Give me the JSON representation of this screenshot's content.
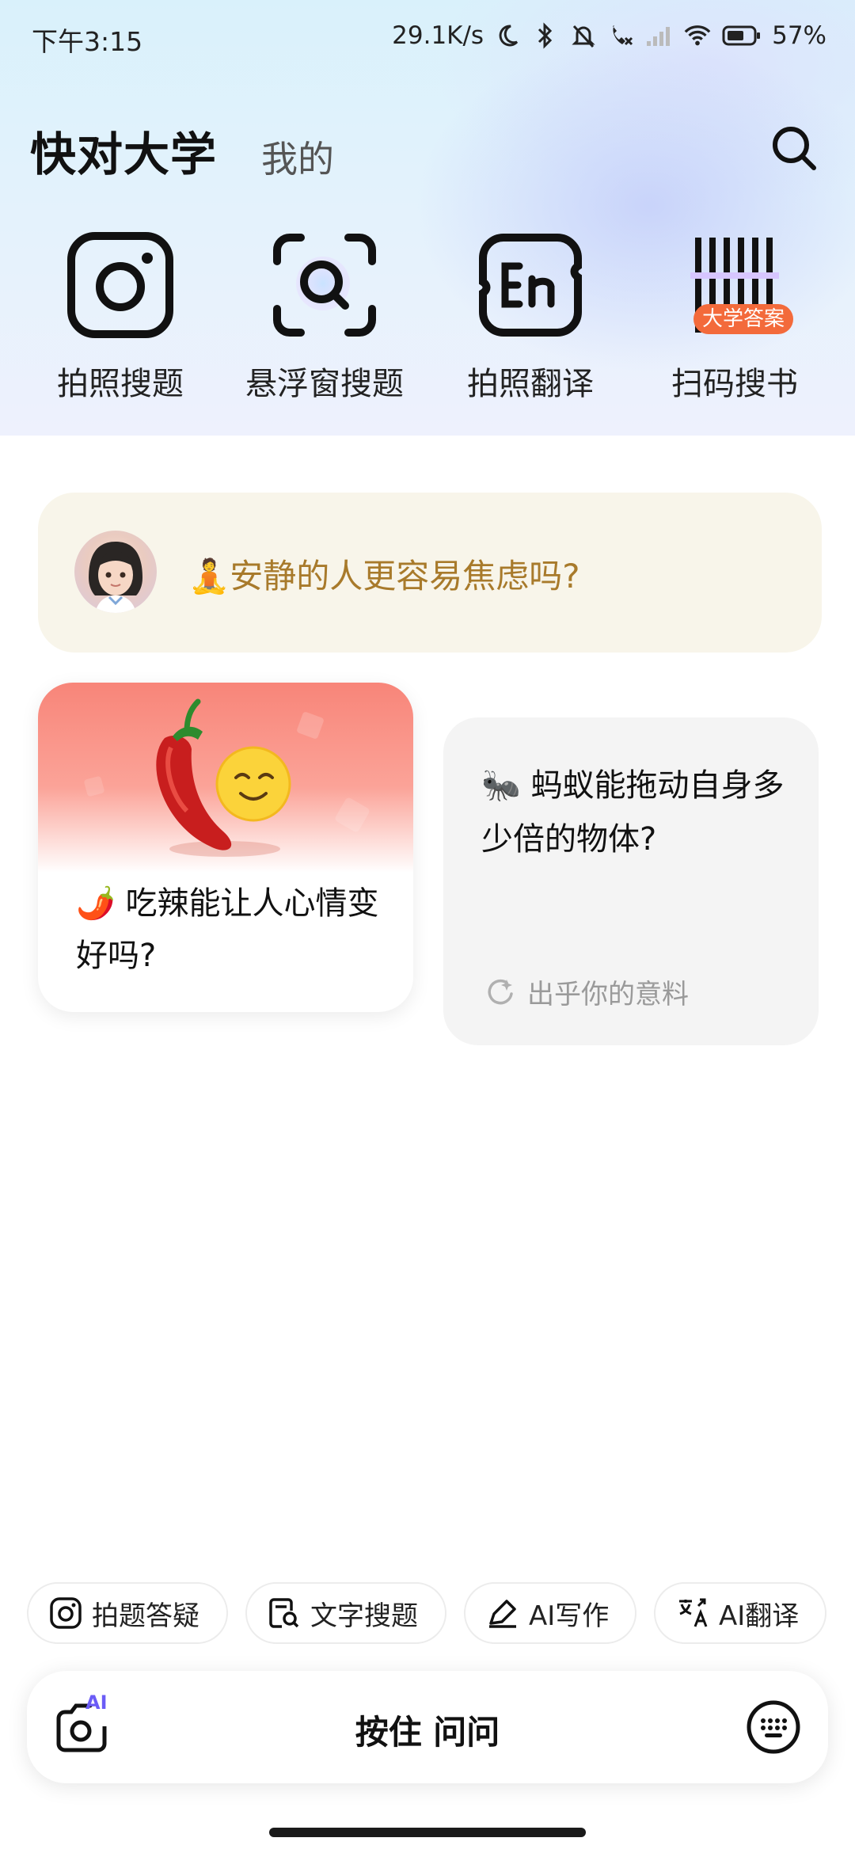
{
  "status_bar": {
    "time": "下午3:15",
    "net_speed": "29.1K/s",
    "battery": "57%",
    "icons": [
      "moon-icon",
      "bluetooth-icon",
      "bell-muted-icon",
      "call-icon",
      "signal-icon",
      "wifi-icon",
      "battery-icon"
    ]
  },
  "header": {
    "title": "快对大学",
    "tab_mine": "我的",
    "search_icon": "search-icon"
  },
  "tools": [
    {
      "label": "拍照搜题",
      "icon": "camera-icon"
    },
    {
      "label": "悬浮窗搜题",
      "icon": "float-search-icon"
    },
    {
      "label": "拍照翻译",
      "icon": "translate-en-icon"
    },
    {
      "label": "扫码搜书",
      "icon": "barcode-icon",
      "tag": "大学答案"
    }
  ],
  "question_card": {
    "emoji": "🧘",
    "text": "安静的人更容易焦虑吗?"
  },
  "card_left": {
    "emoji": "🌶️",
    "text": "吃辣能让人心情变好吗?"
  },
  "card_right": {
    "emoji": "🐜",
    "text": "蚂蚁能拖动自身多少倍的物体?",
    "hint": "出乎你的意料"
  },
  "chips": [
    {
      "label": "拍题答疑",
      "icon": "camera-small-icon"
    },
    {
      "label": "文字搜题",
      "icon": "doc-search-icon"
    },
    {
      "label": "AI写作",
      "icon": "pen-icon"
    },
    {
      "label": "AI翻译",
      "icon": "translate-icon"
    }
  ],
  "input_bar": {
    "hold_label": "按住 问问",
    "ai_badge": "AI"
  },
  "colors": {
    "accent_orange": "#f36a3b",
    "question_text": "#a87a2b",
    "ai_purple": "#6b5cf6"
  }
}
